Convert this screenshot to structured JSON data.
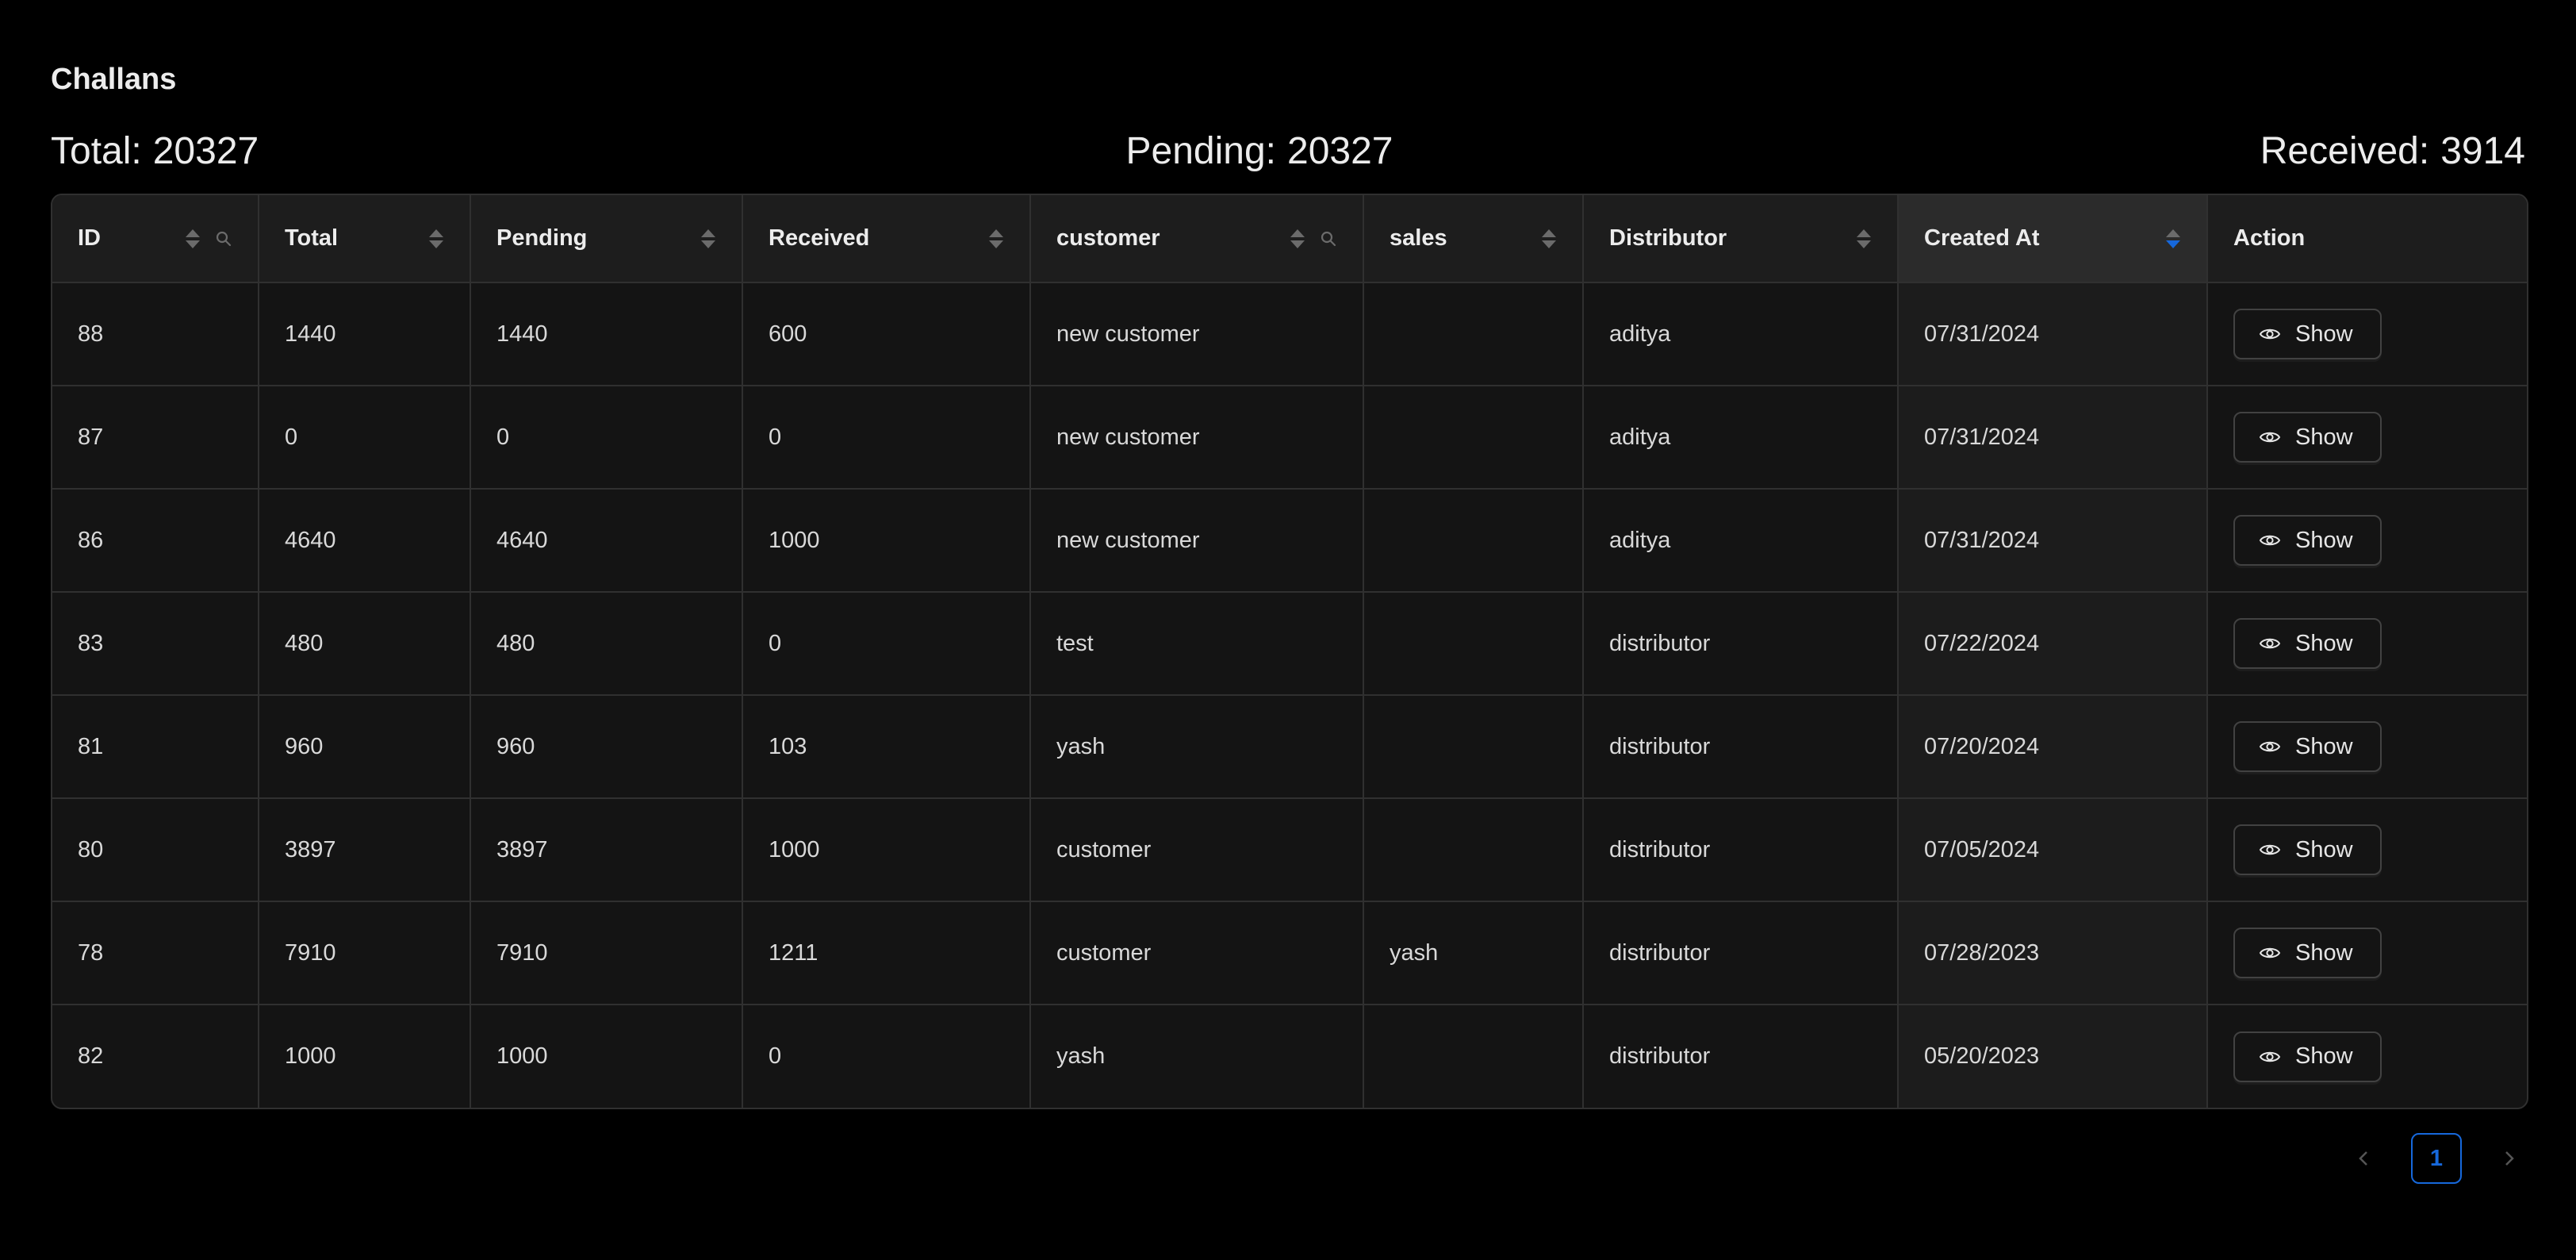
{
  "page": {
    "title": "Challans"
  },
  "stats": {
    "total_label": "Total:",
    "total_value": "20327",
    "pending_label": "Pending:",
    "pending_value": "20327",
    "received_label": "Received:",
    "received_value": "3914"
  },
  "table": {
    "columns": [
      {
        "key": "id",
        "label": "ID",
        "sortable": true,
        "searchable": true
      },
      {
        "key": "total",
        "label": "Total",
        "sortable": true,
        "searchable": false
      },
      {
        "key": "pending",
        "label": "Pending",
        "sortable": true,
        "searchable": false
      },
      {
        "key": "received",
        "label": "Received",
        "sortable": true,
        "searchable": false
      },
      {
        "key": "customer",
        "label": "customer",
        "sortable": true,
        "searchable": true
      },
      {
        "key": "sales",
        "label": "sales",
        "sortable": true,
        "searchable": false
      },
      {
        "key": "distributor",
        "label": "Distributor",
        "sortable": true,
        "searchable": false
      },
      {
        "key": "created_at",
        "label": "Created At",
        "sortable": true,
        "searchable": false,
        "sort": "descend"
      },
      {
        "key": "action",
        "label": "Action",
        "sortable": false,
        "searchable": false
      }
    ],
    "action_label": "Show",
    "rows": [
      {
        "id": "88",
        "total": "1440",
        "pending": "1440",
        "received": "600",
        "customer": "new customer",
        "sales": "",
        "distributor": "aditya",
        "created_at": "07/31/2024"
      },
      {
        "id": "87",
        "total": "0",
        "pending": "0",
        "received": "0",
        "customer": "new customer",
        "sales": "",
        "distributor": "aditya",
        "created_at": "07/31/2024"
      },
      {
        "id": "86",
        "total": "4640",
        "pending": "4640",
        "received": "1000",
        "customer": "new customer",
        "sales": "",
        "distributor": "aditya",
        "created_at": "07/31/2024"
      },
      {
        "id": "83",
        "total": "480",
        "pending": "480",
        "received": "0",
        "customer": "test",
        "sales": "",
        "distributor": "distributor",
        "created_at": "07/22/2024"
      },
      {
        "id": "81",
        "total": "960",
        "pending": "960",
        "received": "103",
        "customer": "yash",
        "sales": "",
        "distributor": "distributor",
        "created_at": "07/20/2024"
      },
      {
        "id": "80",
        "total": "3897",
        "pending": "3897",
        "received": "1000",
        "customer": "customer",
        "sales": "",
        "distributor": "distributor",
        "created_at": "07/05/2024"
      },
      {
        "id": "78",
        "total": "7910",
        "pending": "7910",
        "received": "1211",
        "customer": "customer",
        "sales": "yash",
        "distributor": "distributor",
        "created_at": "07/28/2023"
      },
      {
        "id": "82",
        "total": "1000",
        "pending": "1000",
        "received": "0",
        "customer": "yash",
        "sales": "",
        "distributor": "distributor",
        "created_at": "05/20/2023"
      }
    ]
  },
  "pagination": {
    "current_page": "1",
    "prev_icon": "chevron-left-icon",
    "next_icon": "chevron-right-icon"
  },
  "colors": {
    "accent": "#1668dc",
    "background": "#000000",
    "table_bg": "#141414",
    "border": "#303030"
  }
}
